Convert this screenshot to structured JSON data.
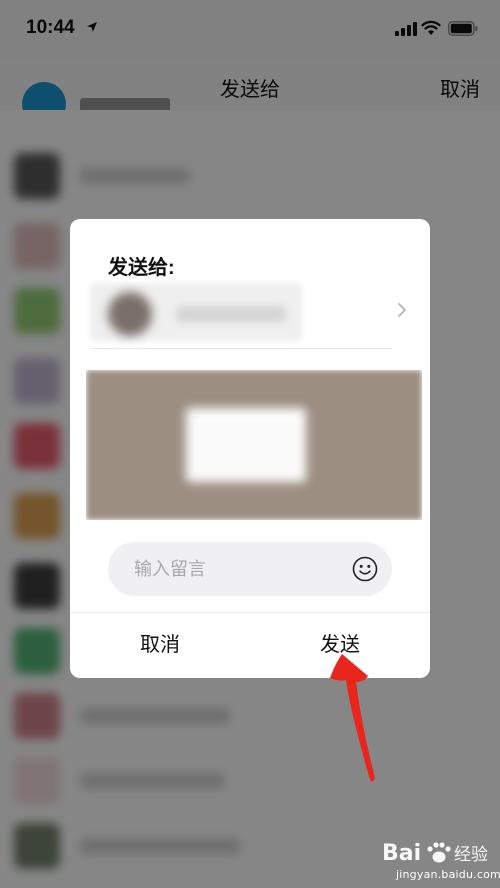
{
  "status_bar": {
    "time": "10:44"
  },
  "nav": {
    "title": "发送给",
    "cancel": "取消"
  },
  "dialog": {
    "title": "发送给:",
    "message_placeholder": "输入留言",
    "cancel_label": "取消",
    "send_label": "发送"
  },
  "watermark": {
    "site": "jingyan.baidu.com"
  },
  "colors": {
    "top_avatar": "#1a93c7",
    "annotation_arrow": "#e8261c"
  }
}
